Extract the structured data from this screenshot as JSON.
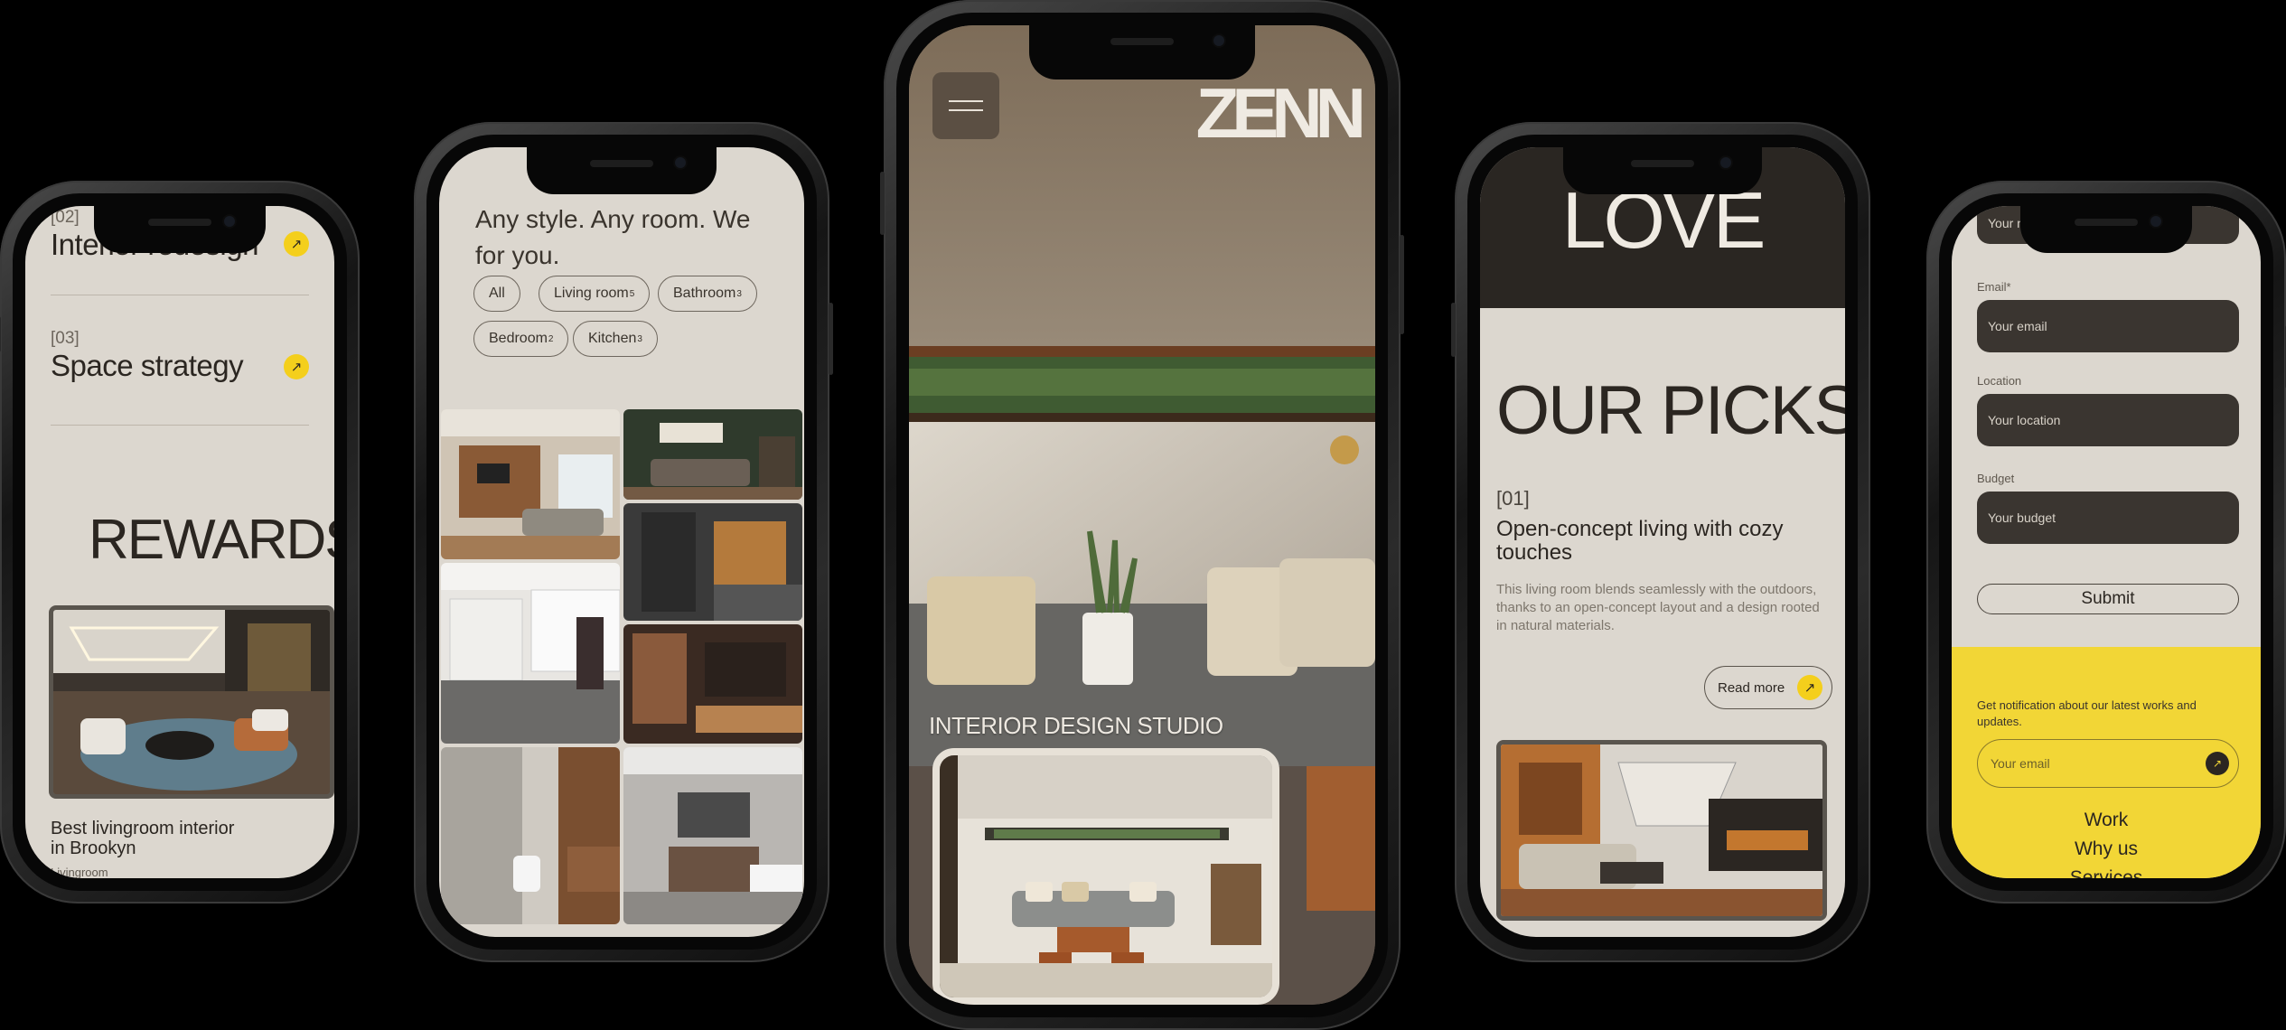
{
  "phone1": {
    "service_items": [
      {
        "number": "[02]",
        "title": "Interior redesign"
      },
      {
        "number": "[03]",
        "title": "Space strategy"
      }
    ],
    "rewards_heading": "REWARDS",
    "card_title": "Best livingroom interior in Brookyn",
    "card_tag": "Livingroom"
  },
  "phone2": {
    "tagline": "Any style. Any room. We for you.",
    "filters": [
      {
        "label": "All",
        "count": ""
      },
      {
        "label": "Living room",
        "count": "5"
      },
      {
        "label": "Bathroom",
        "count": "3"
      },
      {
        "label": "Bedroom",
        "count": "2"
      },
      {
        "label": "Kitchen",
        "count": "3"
      }
    ]
  },
  "phone3": {
    "logo": "ZENN",
    "hero_text": "INTERIOR DESIGN STUDIO"
  },
  "phone4": {
    "band_text": "LOVE",
    "heading": "OUR PICKS",
    "item_number": "[01]",
    "item_title": "Open-concept living with cozy touches",
    "item_description": "This living room blends seamlessly with the outdoors, thanks to an open-concept layout and a design rooted in natural materials.",
    "read_more": "Read more"
  },
  "phone5": {
    "name_placeholder": "Your name",
    "email_label": "Email*",
    "email_placeholder": "Your email",
    "location_label": "Location",
    "location_placeholder": "Your location",
    "budget_label": "Budget",
    "budget_placeholder": "Your budget",
    "submit_label": "Submit",
    "newsletter_text": "Get notification about our latest works and updates.",
    "newsletter_placeholder": "Your email",
    "nav_links": [
      "Work",
      "Why us",
      "Services"
    ]
  },
  "colors": {
    "accent_yellow": "#f4cf1c",
    "background_beige": "#dbd6ce",
    "dark_brown": "#2a2622"
  },
  "icons": {
    "arrow": "↗",
    "send": "↗"
  }
}
